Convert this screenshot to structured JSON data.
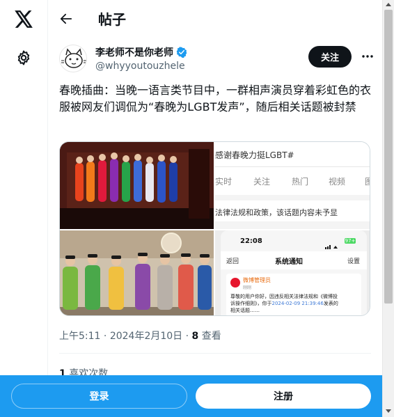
{
  "nav": {
    "logo_icon": "x-logo-icon",
    "settings_icon": "gear-icon"
  },
  "header": {
    "back_icon": "arrow-left-icon",
    "title": "帖子"
  },
  "author": {
    "name": "李老师不是你老师",
    "verified_icon": "verified-badge-icon",
    "handle": "@whyyoutouzhele",
    "follow_label": "关注",
    "more_icon": "more-icon"
  },
  "post": {
    "text": "春晚插曲：当晚一语言类节目中，一群相声演员穿着彩虹色的衣服被网友们调侃为“春晚为LGBT发声”，随后相关话题被封禁"
  },
  "media": {
    "weibo_topic": "感谢春晚力挺LGBT#",
    "weibo_tabs": [
      "实时",
      "关注",
      "热门",
      "视频",
      "图"
    ],
    "weibo_notice": "法律法规和政策，该话题内容未予显",
    "phone_time": "22:08",
    "phone_battery": "97+",
    "notice_back": "返回",
    "notice_title": "系统通知",
    "notice_settings": "设置",
    "notice_sender": "微博管理员",
    "notice_sender_sub": "刚刚",
    "notice_body_1": "尊敬的用户你好，因违反相关法律法规和《微博投",
    "notice_body_2": "诉操作细则》，你于",
    "notice_date": "2024-02-09 21:39:46",
    "notice_body_3": "发表的",
    "notice_body_4": "相关话题……"
  },
  "meta": {
    "time": "上午5:11",
    "sep1": " · ",
    "date": "2024年2月10日",
    "sep2": " · ",
    "views_count": "8",
    "views_label": " 查看"
  },
  "stats": {
    "likes_count": "1",
    "likes_label": " 喜欢次数"
  },
  "bottom": {
    "login_label": "登录",
    "signup_label": "注册"
  },
  "colors": {
    "accent": "#1d9bf0",
    "text": "#0f1419",
    "muted": "#536471"
  }
}
